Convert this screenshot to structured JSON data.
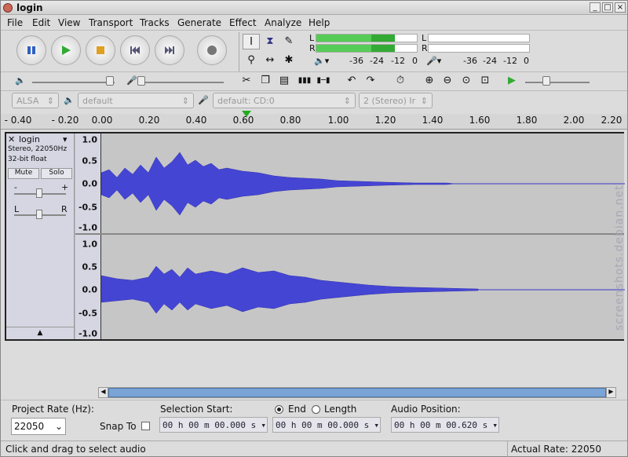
{
  "window": {
    "title": "login",
    "min": "_",
    "max": "□",
    "close": "×"
  },
  "menu": [
    "File",
    "Edit",
    "View",
    "Transport",
    "Tracks",
    "Generate",
    "Effect",
    "Analyze",
    "Help"
  ],
  "meters": {
    "left": "L",
    "right": "R",
    "scale_play": [
      "-36",
      "-24",
      "-12",
      "0"
    ],
    "scale_rec": [
      "-36",
      "-24",
      "-12",
      "0"
    ]
  },
  "device": {
    "host": "ALSA",
    "output": "default",
    "input": "default: CD:0",
    "channels": "2 (Stereo) Ir"
  },
  "ruler": [
    "- 0.40",
    "- 0.20",
    "0.00",
    "0.20",
    "0.40",
    "0.60",
    "0.80",
    "1.00",
    "1.20",
    "1.40",
    "1.60",
    "1.80",
    "2.00",
    "2.20"
  ],
  "track": {
    "name": "login",
    "info1": "Stereo, 22050Hz",
    "info2": "32-bit float",
    "mute": "Mute",
    "solo": "Solo",
    "gain_minus": "-",
    "gain_plus": "+",
    "pan_l": "L",
    "pan_r": "R",
    "collapse": "▲"
  },
  "yaxis": [
    "1.0",
    "0.5",
    "0.0",
    "-0.5",
    "-1.0"
  ],
  "bottom": {
    "project_rate_label": "Project Rate (Hz):",
    "project_rate": "22050",
    "snap_label": "Snap To",
    "sel_start_label": "Selection Start:",
    "end_label": "End",
    "length_label": "Length",
    "audio_pos_label": "Audio Position:",
    "sel_start": "00 h 00 m 00.000 s",
    "sel_end": "00 h 00 m 00.000 s",
    "audio_pos": "00 h 00 m 00.620 s"
  },
  "status": {
    "left": "Click and drag to select audio",
    "right": "Actual Rate: 22050"
  },
  "watermark": "screenshots.debian.net"
}
